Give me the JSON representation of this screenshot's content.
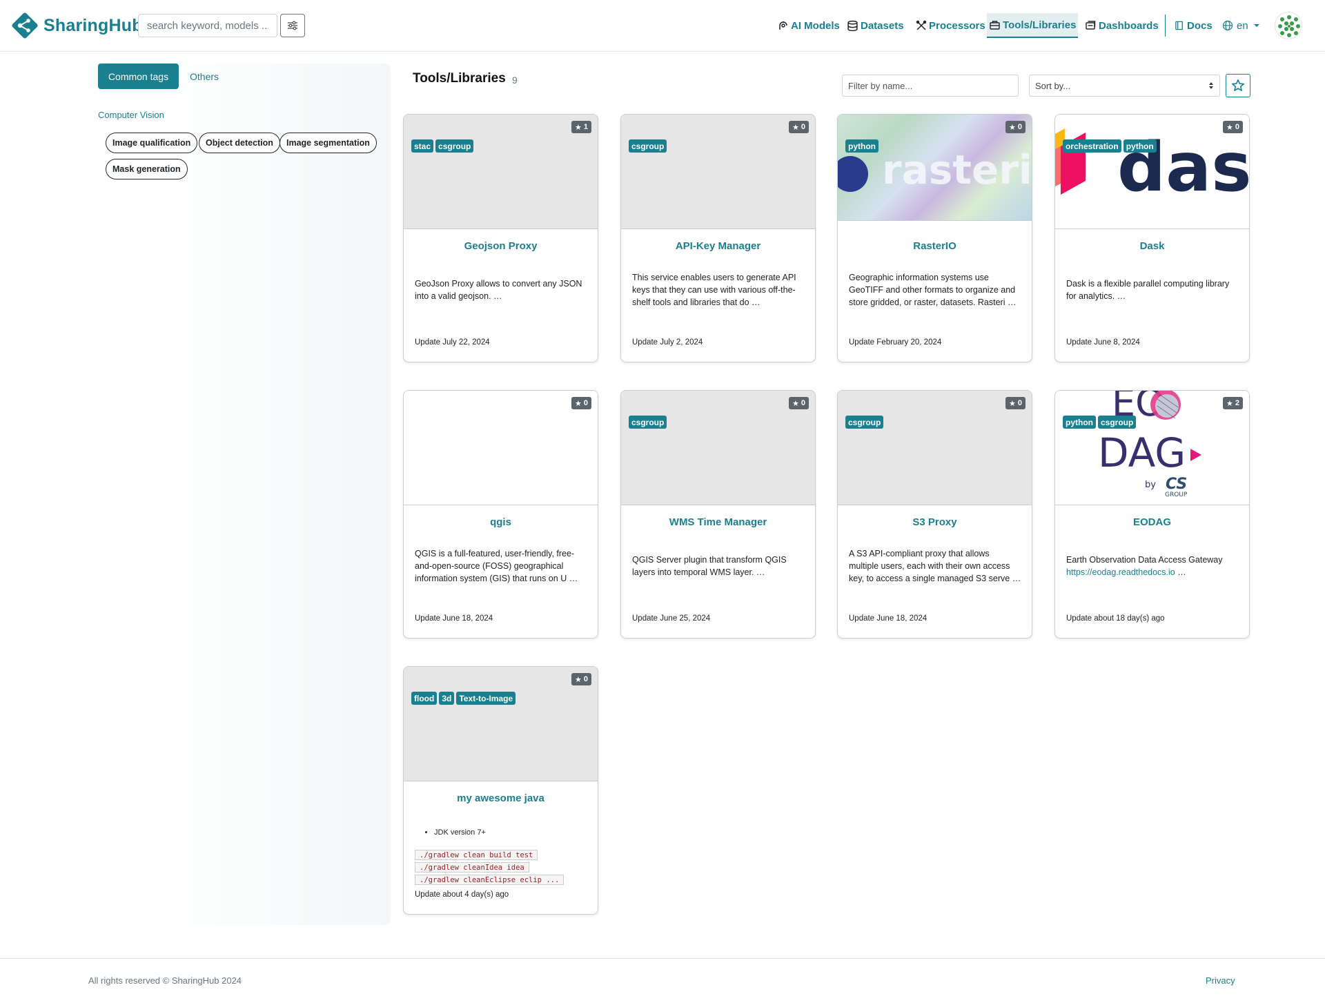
{
  "header": {
    "brand": "SharingHub",
    "search_placeholder": "search keyword, models ...",
    "nav": [
      {
        "label": "AI Models",
        "icon": "ai-models-icon"
      },
      {
        "label": "Datasets",
        "icon": "database-icon"
      },
      {
        "label": "Processors",
        "icon": "tools-icon"
      },
      {
        "label": "Tools/Libraries",
        "icon": "toolbox-icon",
        "active": true
      },
      {
        "label": "Dashboards",
        "icon": "dashboard-icon"
      },
      {
        "label": "Docs",
        "icon": "book-icon"
      },
      {
        "label": "en",
        "icon": "globe-icon"
      }
    ]
  },
  "sidebar": {
    "tab_common": "Common tags",
    "tab_others": "Others",
    "category": "Computer Vision",
    "tags": [
      "Image qualification",
      "Object detection",
      "Image segmentation",
      "Mask generation"
    ]
  },
  "main": {
    "title": "Tools/Libraries",
    "count": "9",
    "filter_placeholder": "Filter by name...",
    "sort_placeholder": "Sort by..."
  },
  "cards": [
    {
      "title": "Geojson Proxy",
      "stars": "1",
      "tags": [
        "stac",
        "csgroup"
      ],
      "desc": "GeoJson Proxy allows to convert any JSON into a valid geojson. …",
      "date": "Update July 22, 2024"
    },
    {
      "title": "API-Key Manager",
      "stars": "0",
      "tags": [
        "csgroup"
      ],
      "desc": "This service enables users to generate API keys that they can use with various off-the-shelf tools and libraries that do …",
      "date": "Update July 2, 2024"
    },
    {
      "title": "RasterIO",
      "stars": "0",
      "tags": [
        "python"
      ],
      "image_text": "rasterio",
      "desc": "Geographic information systems use GeoTIFF and other formats to organize and store gridded, or raster, datasets. Rasteri …",
      "date": "Update February 20, 2024"
    },
    {
      "title": "Dask",
      "stars": "0",
      "tags": [
        "orchestration",
        "python"
      ],
      "image_text": "dask",
      "desc": "Dask is a flexible parallel computing library for analytics. …",
      "date": "Update June 8, 2024"
    },
    {
      "title": "qgis",
      "stars": "0",
      "tags": [],
      "desc": "QGIS is a full-featured, user-friendly, free-and-open-source (FOSS) geographical information system (GIS) that runs on U …",
      "date": "Update June 18, 2024"
    },
    {
      "title": "WMS Time Manager",
      "stars": "0",
      "tags": [
        "csgroup"
      ],
      "desc": "QGIS Server plugin that transform QGIS layers into temporal WMS layer. …",
      "date": "Update June 25, 2024"
    },
    {
      "title": "S3 Proxy",
      "stars": "0",
      "tags": [
        "csgroup"
      ],
      "desc": "A S3 API-compliant proxy that allows multiple users, each with their own access key, to access a single managed S3 serve …",
      "date": "Update June 18, 2024"
    },
    {
      "title": "EODAG",
      "stars": "2",
      "tags": [
        "python",
        "csgroup"
      ],
      "image_text": [
        "EO",
        "DAG",
        "by",
        "CS",
        "GROUP"
      ],
      "desc": "Earth Observation Data Access Gateway",
      "link": "https://eodag.readthedocs.io",
      "link_suffix": " …",
      "date": "Update about 18 day(s) ago"
    },
    {
      "title": "my awesome java",
      "stars": "0",
      "tags": [
        "flood",
        "3d",
        "Text-to-Image"
      ],
      "bullet": "JDK version 7+",
      "code": [
        "./gradlew clean build test",
        "./gradlew cleanIdea idea",
        "./gradlew cleanEclipse eclip ..."
      ],
      "date": "Update about 4 day(s) ago"
    }
  ],
  "footer": {
    "copyright": "All rights reserved © SharingHub 2024",
    "privacy": "Privacy"
  },
  "colors": {
    "accent": "#1a7f8e",
    "badge": "#5c646b"
  }
}
